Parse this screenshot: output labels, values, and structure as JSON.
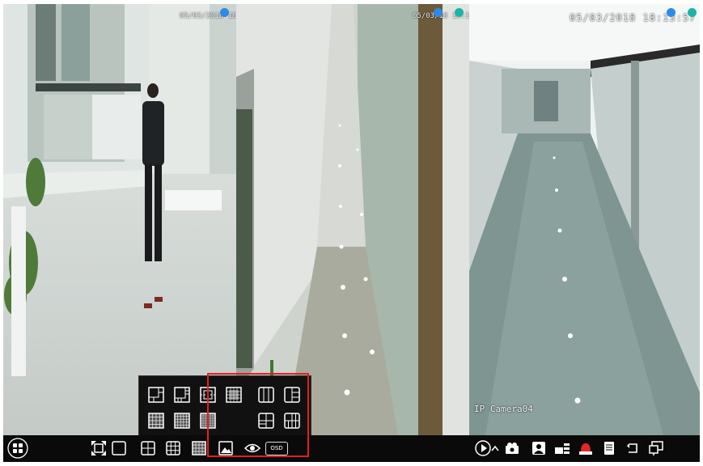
{
  "cameras": [
    {
      "id": "cam1",
      "timestamp": "05/03/2018 18:14"
    },
    {
      "id": "cam2",
      "timestamp": "05/03/18 18:15"
    },
    {
      "id": "cam3",
      "timestamp": "05/03/2018 18:13:57",
      "name": "IP Camera04"
    }
  ],
  "colors": {
    "record_dot": "#2a8be8",
    "motion_dot": "#19b5a8",
    "highlight": "#e02020"
  },
  "toolbar": {
    "left": [
      {
        "name": "start-menu-button",
        "icon": "grid-circle-icon"
      },
      {
        "name": "fullscreen-button",
        "icon": "fullscreen-icon"
      },
      {
        "name": "layout-1-button",
        "icon": "single-screen-icon"
      },
      {
        "name": "layout-4-button",
        "icon": "quad-screen-icon"
      },
      {
        "name": "layout-9-button",
        "icon": "nine-screen-icon"
      },
      {
        "name": "layout-more-button",
        "icon": "multi-screen-icon"
      },
      {
        "name": "image-button",
        "icon": "picture-icon"
      },
      {
        "name": "dwell-button",
        "icon": "eye-icon"
      },
      {
        "name": "osd-button",
        "label": "OSD"
      }
    ],
    "right": [
      {
        "name": "playback-button",
        "icon": "play-circle-icon"
      },
      {
        "name": "expand-button",
        "icon": "chevron-up-icon"
      },
      {
        "name": "manual-record-button",
        "icon": "record-camera-icon"
      },
      {
        "name": "snapshot-button",
        "icon": "person-snapshot-icon"
      },
      {
        "name": "audio-button",
        "icon": "speaker-icon"
      },
      {
        "name": "alarm-button",
        "icon": "alarm-light-icon"
      },
      {
        "name": "disk-button",
        "icon": "disk-icon"
      },
      {
        "name": "exit-button",
        "icon": "return-icon"
      },
      {
        "name": "window-button",
        "icon": "windows-icon"
      }
    ]
  },
  "layout_popup": {
    "options": [
      "layout-1+5",
      "layout-1+7",
      "layout-1+9",
      "layout-1+12",
      "layout-3",
      "layout-4x",
      "layout-16",
      "layout-25",
      "layout-36",
      "layout-6",
      "layout-8"
    ]
  }
}
